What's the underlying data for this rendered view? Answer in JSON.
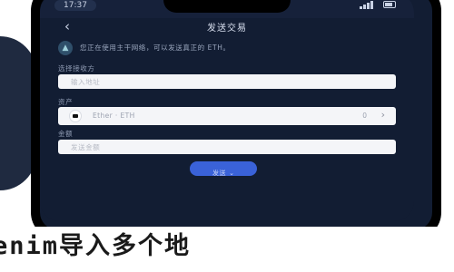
{
  "status_bar": {
    "time": "17:37"
  },
  "header": {
    "title": "发送交易",
    "back_icon": "chevron-left-icon"
  },
  "notice": {
    "icon": "warning-triangle-icon",
    "text": "您正在使用主干网络，可以发送真正的 ETH。"
  },
  "form": {
    "recipient": {
      "label": "选择接收方",
      "placeholder": "输入地址"
    },
    "asset": {
      "label": "资产",
      "name": "Ether · ETH",
      "balance": "0",
      "icon": "ethereum-icon"
    },
    "amount": {
      "label": "金额",
      "placeholder": "发送金额"
    }
  },
  "send_button": {
    "label": "发送"
  },
  "caption": {
    "text": "enim导入多个地"
  },
  "colors": {
    "background": "#121d33",
    "accent": "#3a62d8",
    "frame_edge": "#d6183f"
  }
}
